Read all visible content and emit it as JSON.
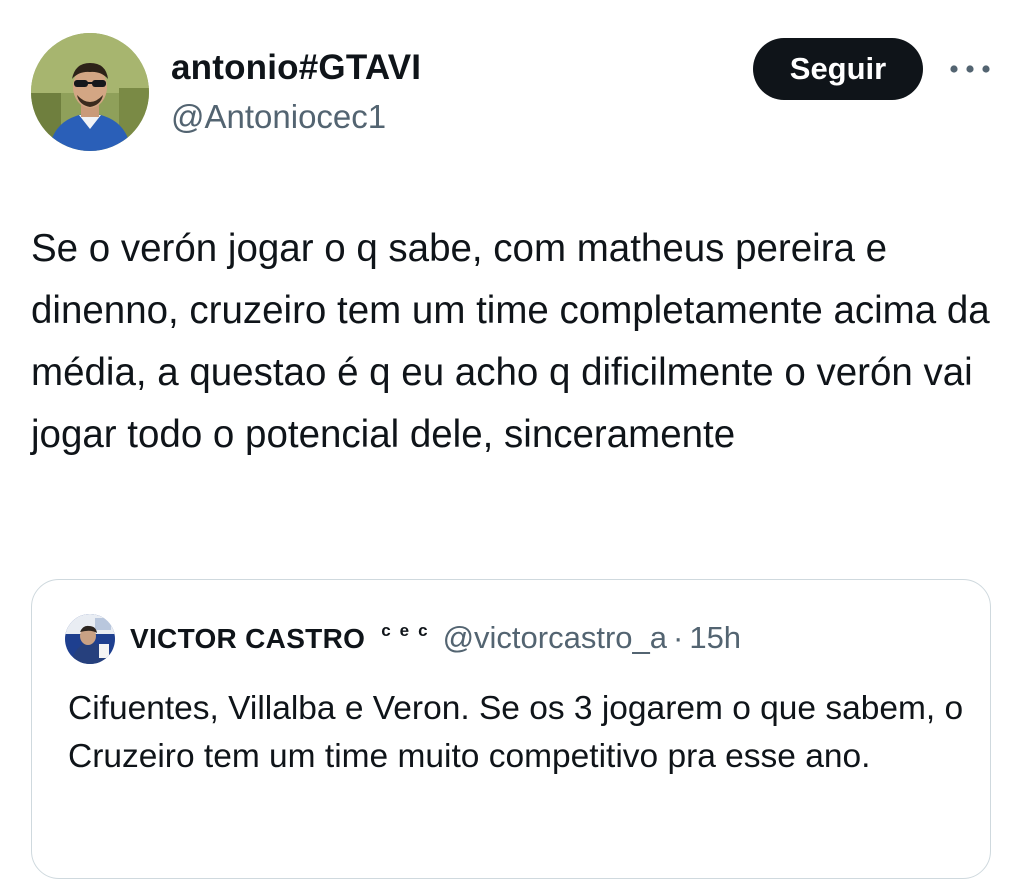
{
  "author": {
    "display_name": "antonio#GTAVI",
    "handle": "@Antoniocec1"
  },
  "follow_button": {
    "label": "Seguir"
  },
  "more_button": {
    "icon": "more-dots-icon"
  },
  "tweet": {
    "text": "Se o verón jogar o q sabe, com matheus pereira e dinenno, cruzeiro tem um time completamente acima da média, a questao é q eu acho q dificilmente o verón vai jogar todo o potencial dele, sinceramente"
  },
  "quoted_tweet": {
    "display_name": "VICTOR CASTRO",
    "name_tag": "cec",
    "handle": "@victorcastro_a",
    "separator": "·",
    "time": "15h",
    "text": "Cifuentes, Villalba e Veron. Se os 3 jogarem o que sabem, o Cruzeiro tem um time muito competitivo pra esse ano."
  },
  "colors": {
    "text": "#0f1419",
    "secondary": "#536471",
    "border": "#cfd9de",
    "button_bg": "#0f1419"
  }
}
